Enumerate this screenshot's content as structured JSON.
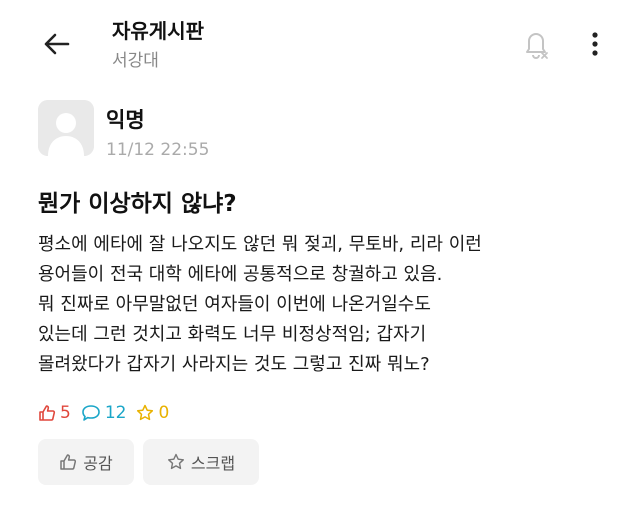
{
  "header": {
    "board_title": "자유게시판",
    "school_name": "서강대",
    "back_icon": "arrow-left-icon",
    "notify_icon": "bell-off-icon",
    "more_icon": "more-vertical-icon"
  },
  "post": {
    "author": "익명",
    "timestamp": "11/12 22:55",
    "title": "뭔가 이상하지 않냐?",
    "body_lines": [
      "평소에 에타에 잘 나오지도 않던 뭐 젖괴, 무토바, 리라 이런",
      "용어들이 전국 대학 에타에 공통적으로 창궐하고 있음.",
      "뭐 진짜로 아무말없던 여자들이 이번에 나온거일수도",
      "있는데 그런 것치고 화력도 너무 비정상적임; 갑자기",
      "몰려왔다가 갑자기 사라지는 것도 그렇고 진짜 뭐노?"
    ],
    "stats": {
      "likes": "5",
      "comments": "12",
      "scraps": "0"
    }
  },
  "actions": {
    "like_label": "공감",
    "scrap_label": "스크랩"
  },
  "colors": {
    "like": "#e0473c",
    "comment": "#1aa6c8",
    "scrap": "#e9b200",
    "secondary_text": "#888888",
    "button_bg": "#f3f3f3"
  }
}
